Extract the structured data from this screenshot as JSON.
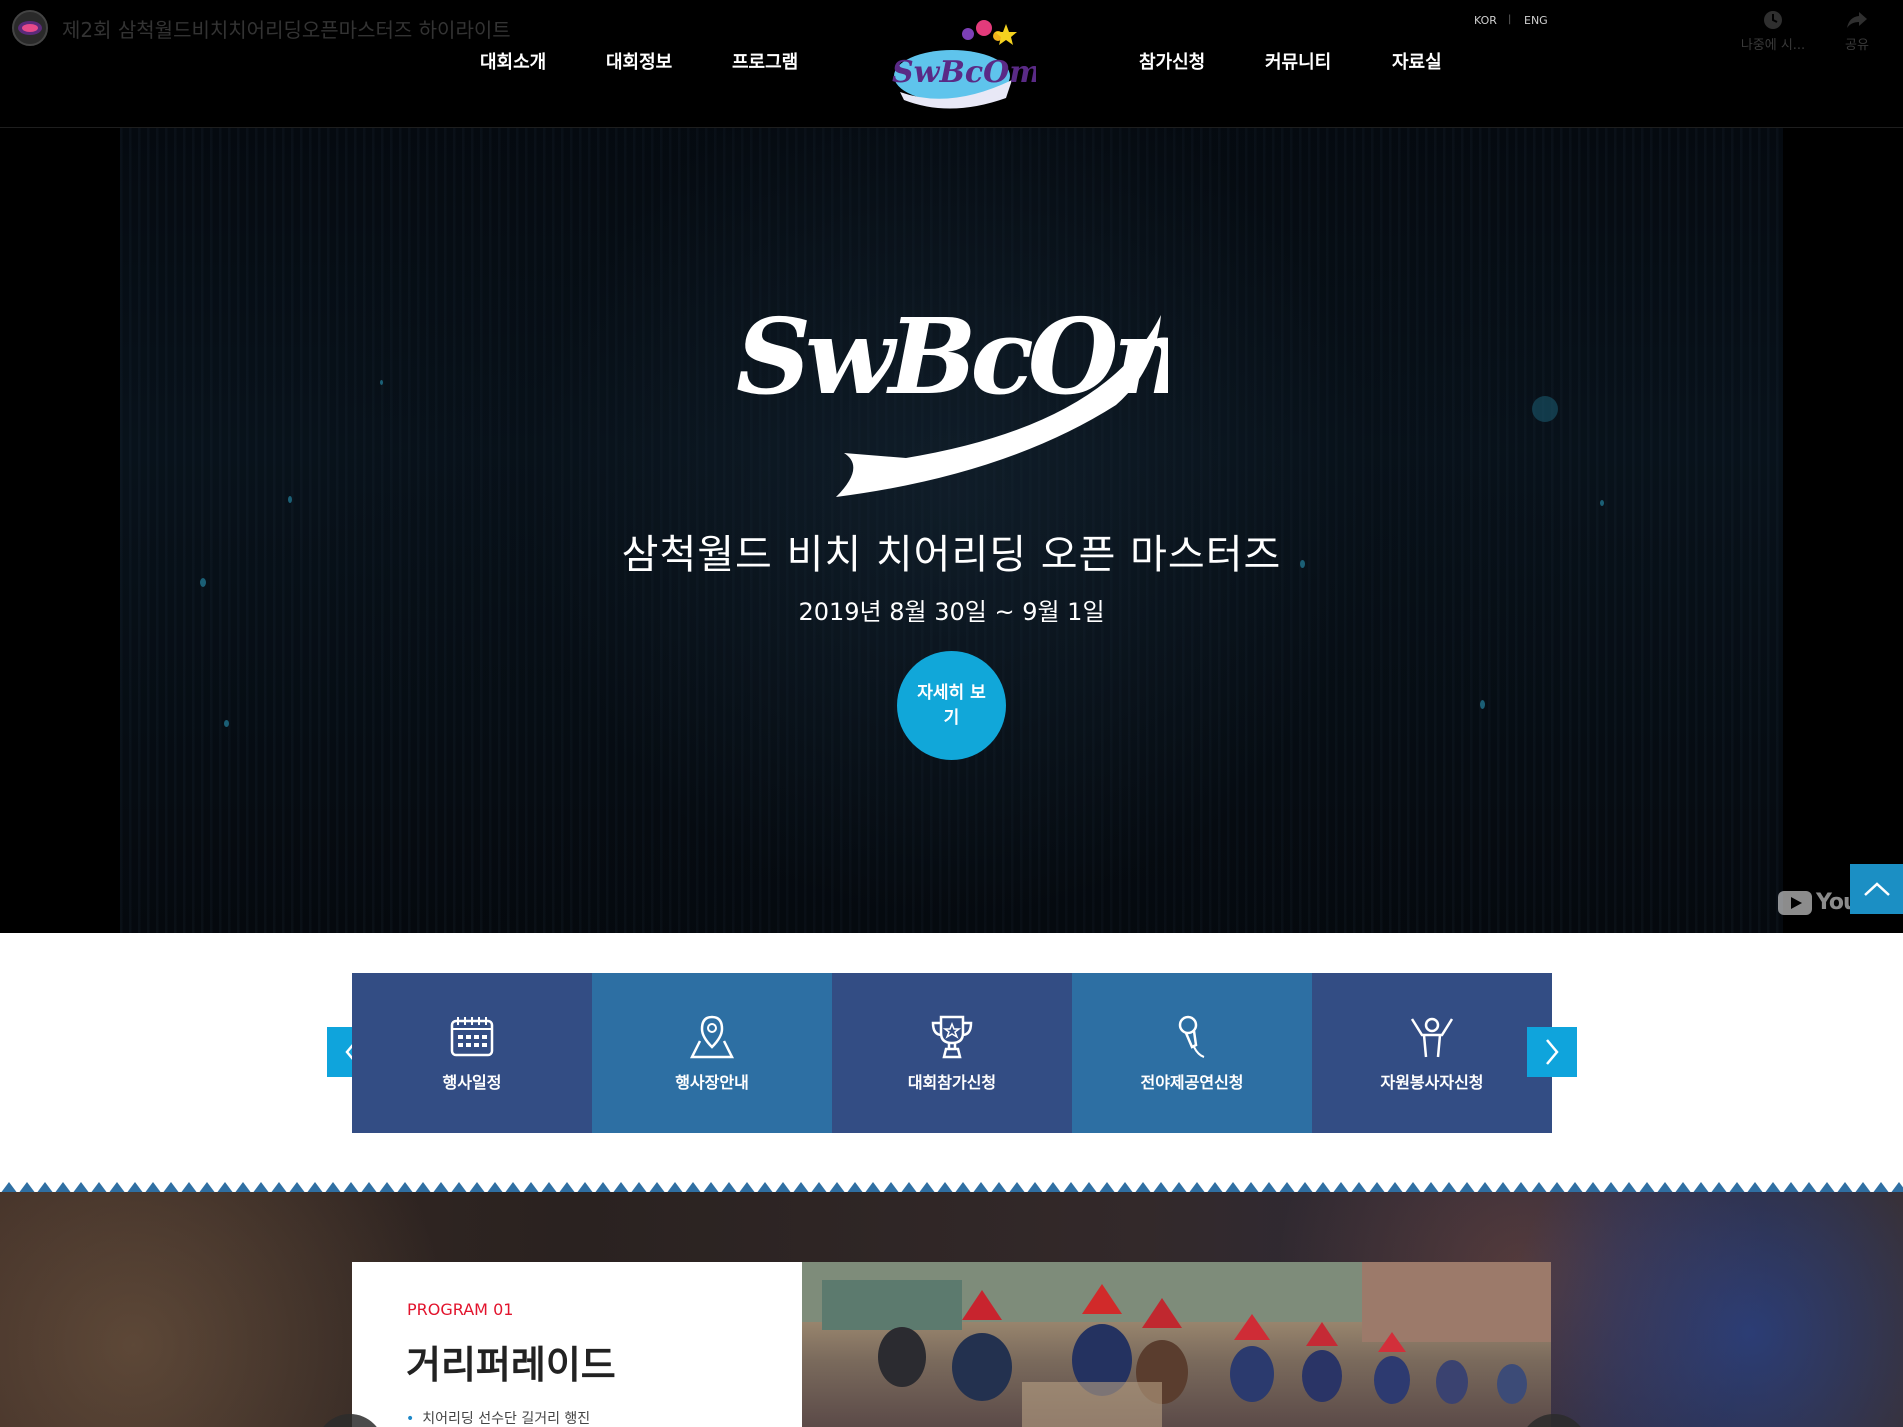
{
  "youtube": {
    "video_title": "제2회 삼척월드비치치어리딩오픈마스터즈 하이라이트",
    "watch_later_label": "나중에 시...",
    "share_label": "공유"
  },
  "header": {
    "nav_left": [
      "대회소개",
      "대회정보",
      "프로그램"
    ],
    "nav_right": [
      "참가신청",
      "커뮤니티",
      "자료실"
    ],
    "lang": [
      "KOR",
      "ENG"
    ],
    "lang_separator": "|",
    "logo_text": "SwBcOm"
  },
  "hero": {
    "logo_text": "SwBcOm",
    "title": "삼척월드 비치 치어리딩 오픈 마스터즈",
    "date": "2019년 8월 30일 ~ 9월 1일",
    "detail_button": "자세히 보기",
    "youtube_word": "YouTube"
  },
  "quick_menu": {
    "items": [
      {
        "label": "행사일정",
        "icon": "calendar-icon"
      },
      {
        "label": "행사장안내",
        "icon": "map-pin-icon"
      },
      {
        "label": "대회참가신청",
        "icon": "trophy-icon"
      },
      {
        "label": "전야제공연신청",
        "icon": "microphone-icon"
      },
      {
        "label": "자원봉사자신청",
        "icon": "cheer-person-icon"
      }
    ]
  },
  "program": {
    "number": "PROGRAM 01",
    "title": "거리퍼레이드",
    "desc": "치어리딩 선수단 길거리 행진"
  },
  "colors": {
    "header_bg": "#000000",
    "accent_blue": "#11a7d9",
    "quick_dark": "#334d84",
    "quick_light": "#2d6fa3",
    "program_red": "#e2142d"
  }
}
